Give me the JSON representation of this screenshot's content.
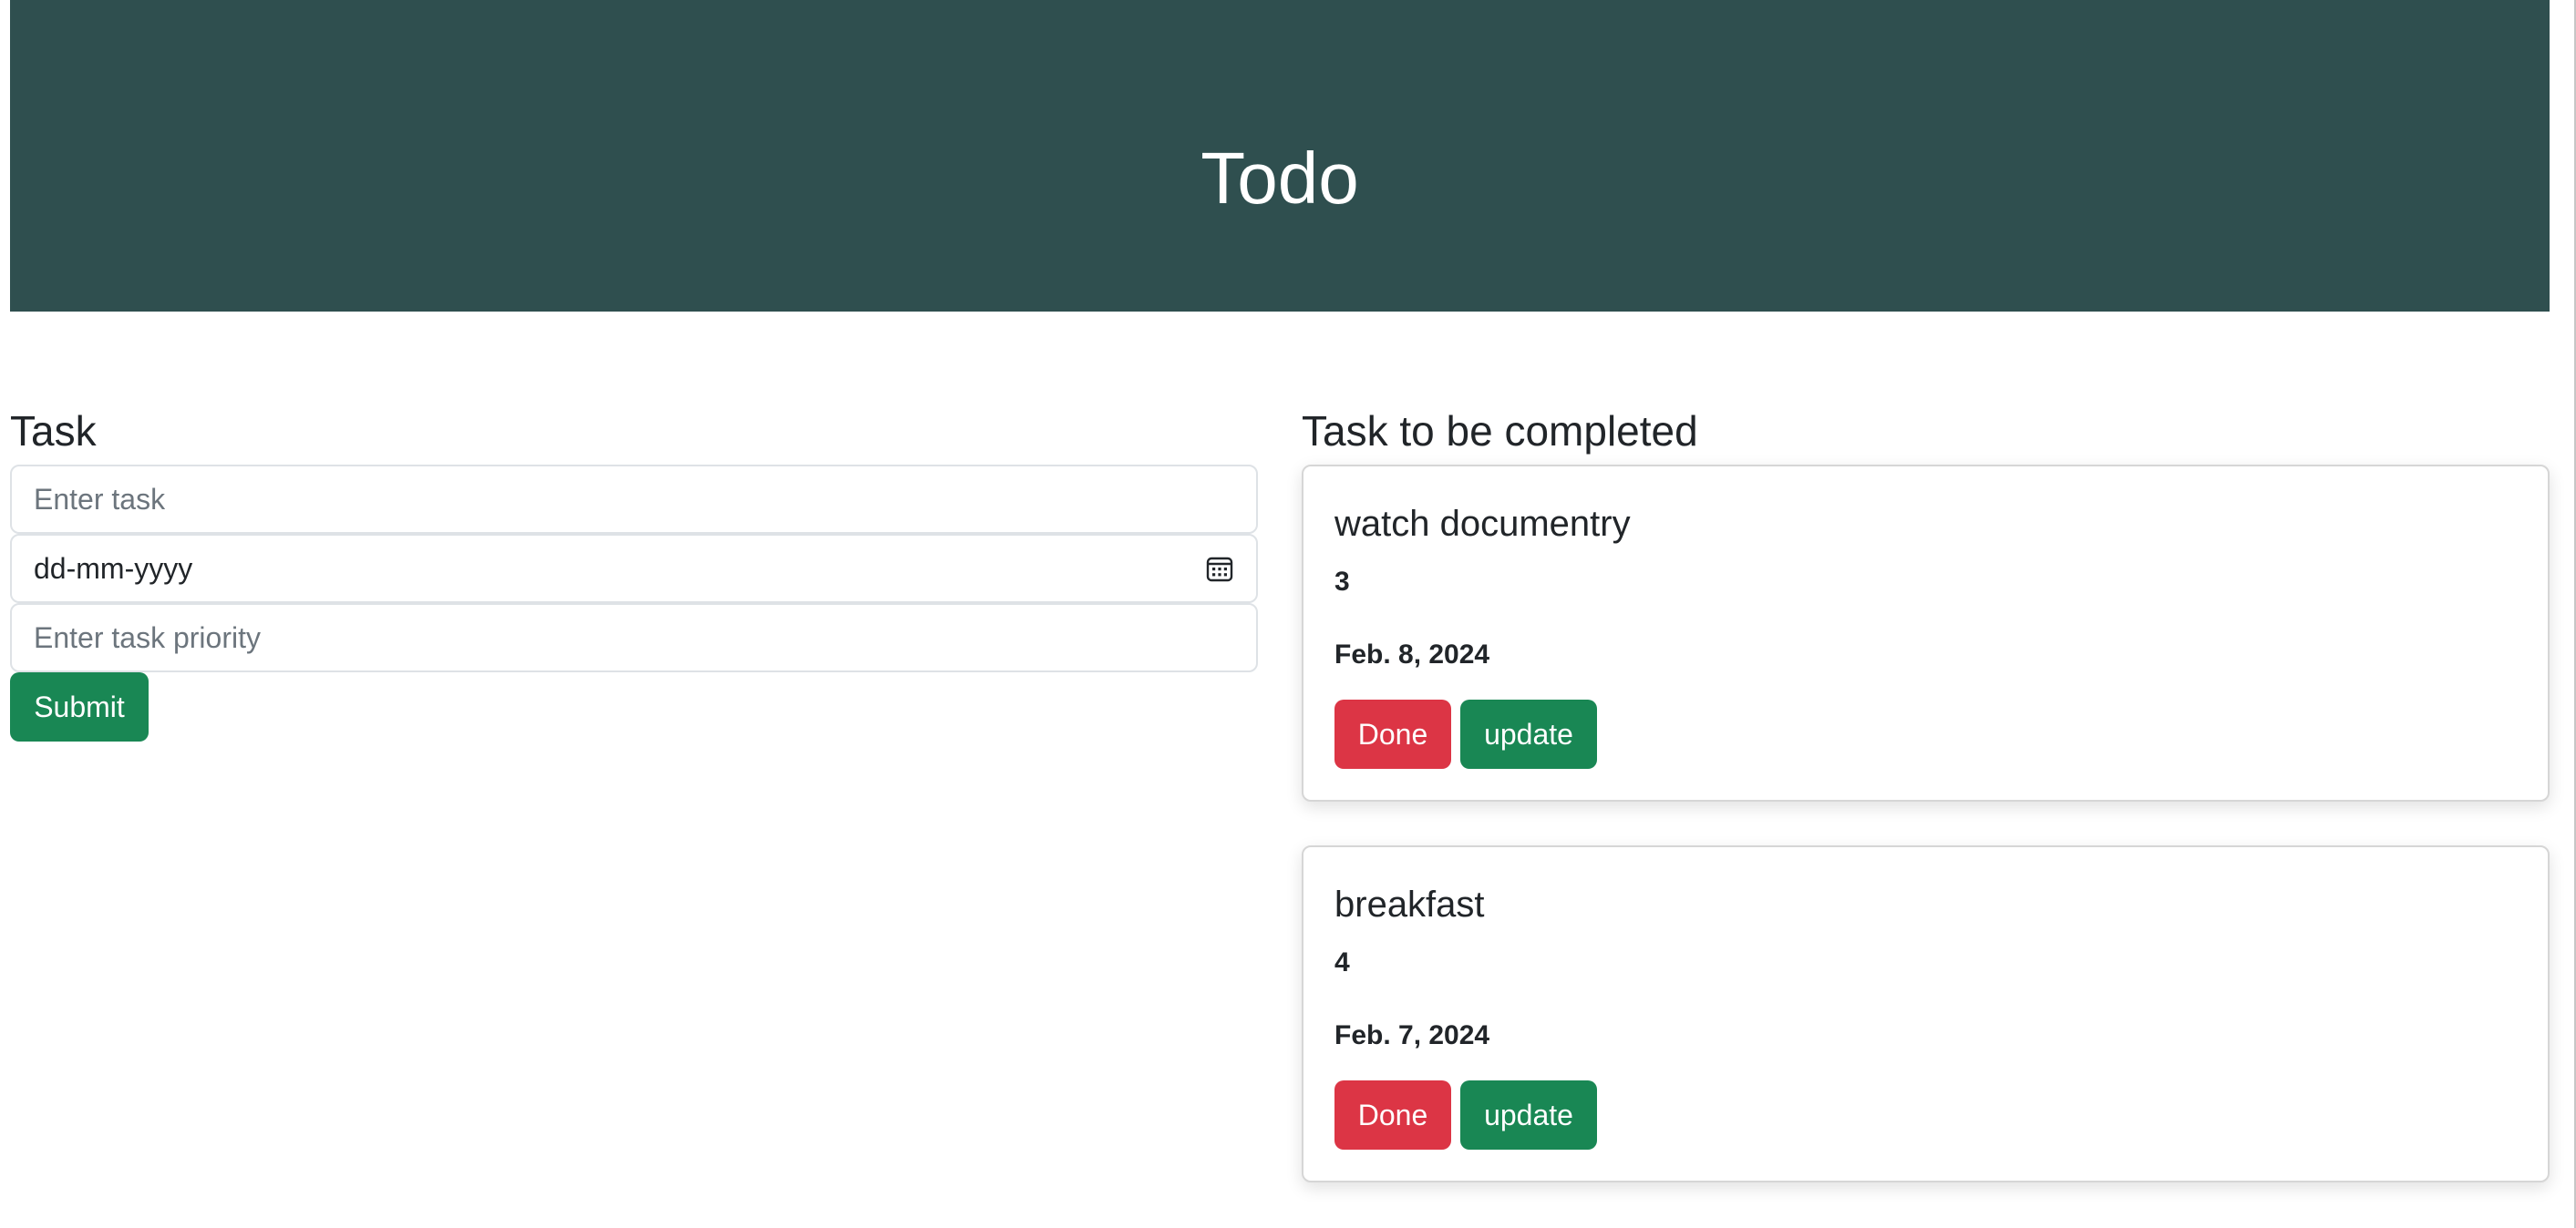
{
  "header": {
    "title": "Todo"
  },
  "form": {
    "section_title": "Task",
    "task_placeholder": "Enter task",
    "date_value": "dd-mm-yyyy",
    "priority_placeholder": "Enter task priority",
    "submit_label": "Submit"
  },
  "tasks": {
    "section_title": "Task to be completed",
    "items": [
      {
        "name": "watch documentry",
        "priority": "3",
        "date": "Feb. 8, 2024",
        "done_label": "Done",
        "update_label": "update"
      },
      {
        "name": "breakfast",
        "priority": "4",
        "date": "Feb. 7, 2024",
        "done_label": "Done",
        "update_label": "update"
      }
    ]
  },
  "colors": {
    "header_bg": "#2f4f4f",
    "success": "#198754",
    "danger": "#dc3545"
  },
  "icons": {
    "date_picker": "calendar-icon"
  }
}
